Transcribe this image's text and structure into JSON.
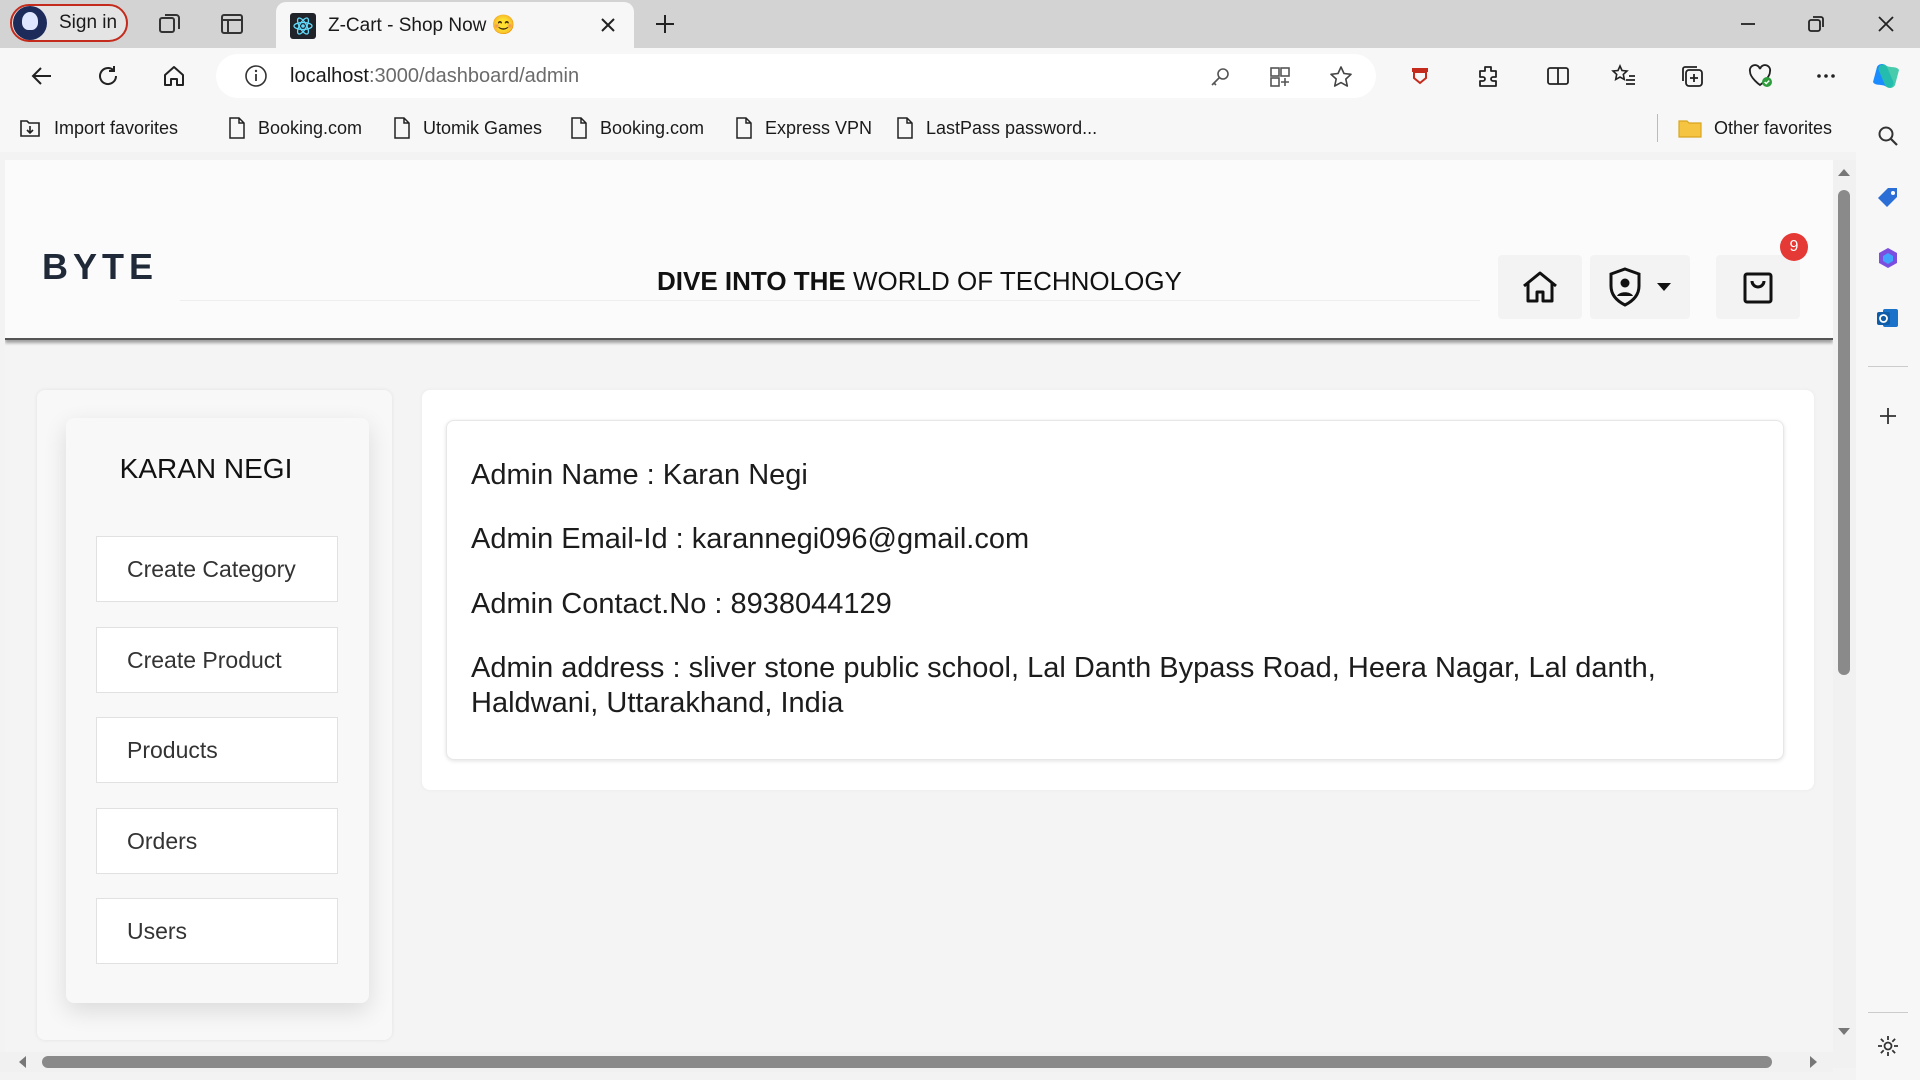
{
  "browser": {
    "signin_label": "Sign in",
    "tab_title": "Z-Cart - Shop Now 😊",
    "url_host": "localhost",
    "url_path": ":3000/dashboard/admin",
    "favorites": [
      {
        "label": "Import favorites",
        "icon": "import-icon"
      },
      {
        "label": "Booking.com",
        "icon": "page-icon"
      },
      {
        "label": "Utomik Games",
        "icon": "page-icon"
      },
      {
        "label": "Booking.com",
        "icon": "page-icon"
      },
      {
        "label": "Express VPN",
        "icon": "page-icon"
      },
      {
        "label": "LastPass password...",
        "icon": "page-icon"
      }
    ],
    "other_favorites": "Other favorites"
  },
  "header": {
    "brand": "BYTE",
    "tagline_bold": "DIVE INTO THE",
    "tagline_rest": " WORLD OF TECHNOLOGY",
    "cart_count": "9"
  },
  "sidebar": {
    "user_name": "KARAN NEGI",
    "items": [
      {
        "label": "Create Category"
      },
      {
        "label": "Create Product"
      },
      {
        "label": "Products"
      },
      {
        "label": "Orders"
      },
      {
        "label": "Users"
      }
    ]
  },
  "admin_info": {
    "name": "Admin Name : Karan Negi",
    "email": "Admin Email-Id : karannegi096@gmail.com",
    "contact": "Admin Contact.No : 8938044129",
    "address": "Admin address : sliver stone public school, Lal Danth Bypass Road, Heera Nagar, Lal danth, Haldwani, Uttarakhand, India"
  },
  "colors": {
    "badge": "#e53935",
    "signin_border": "#c42b1c",
    "brand": "#1f2937"
  }
}
